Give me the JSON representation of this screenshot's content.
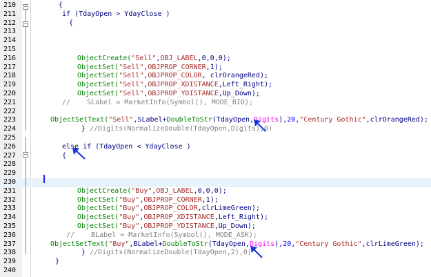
{
  "colors": {
    "keyword": "#000080",
    "function": "#008000",
    "string": "#a52a2a",
    "constant": "#0000ff",
    "digits": "#ff00ff",
    "comment": "#808080",
    "plain": "#000080",
    "arrow": "#1a39d6"
  },
  "lines": [
    {
      "num": "210",
      "indent": 85,
      "tokens": [
        {
          "t": "{",
          "c": "plain"
        }
      ]
    },
    {
      "num": "211",
      "indent": 90,
      "tokens": [
        {
          "t": "if (TdayOpen > YdayClose )",
          "c": "plain"
        }
      ]
    },
    {
      "num": "212",
      "indent": 100,
      "tokens": [
        {
          "t": "{",
          "c": "plain"
        }
      ]
    },
    {
      "num": "213",
      "indent": 100,
      "tokens": []
    },
    {
      "num": "214",
      "indent": 100,
      "tokens": []
    },
    {
      "num": "215",
      "indent": 100,
      "tokens": []
    },
    {
      "num": "216",
      "indent": 112,
      "tokens": [
        {
          "t": "ObjectCreate(",
          "c": "function"
        },
        {
          "t": "\"Sell\"",
          "c": "string"
        },
        {
          "t": ",",
          "c": "plain"
        },
        {
          "t": "OBJ_LABEL",
          "c": "string"
        },
        {
          "t": ",0,0,0);",
          "c": "plain"
        }
      ]
    },
    {
      "num": "217",
      "indent": 112,
      "tokens": [
        {
          "t": "ObjectSet(",
          "c": "function"
        },
        {
          "t": "\"Sell\"",
          "c": "string"
        },
        {
          "t": ",",
          "c": "plain"
        },
        {
          "t": "OBJPROP_CORNER",
          "c": "string"
        },
        {
          "t": ",1);",
          "c": "plain"
        }
      ]
    },
    {
      "num": "218",
      "indent": 112,
      "tokens": [
        {
          "t": "ObjectSet(",
          "c": "function"
        },
        {
          "t": "\"Sell\"",
          "c": "string"
        },
        {
          "t": ",",
          "c": "plain"
        },
        {
          "t": "OBJPROP_COLOR",
          "c": "string"
        },
        {
          "t": ", clrOrangeRed);",
          "c": "plain"
        }
      ]
    },
    {
      "num": "219",
      "indent": 112,
      "tokens": [
        {
          "t": "ObjectSet(",
          "c": "function"
        },
        {
          "t": "\"Sell\"",
          "c": "string"
        },
        {
          "t": ",",
          "c": "plain"
        },
        {
          "t": "OBJPROP_XDISTANCE",
          "c": "string"
        },
        {
          "t": ",Left_Right);",
          "c": "plain"
        }
      ]
    },
    {
      "num": "220",
      "indent": 112,
      "tokens": [
        {
          "t": "ObjectSet(",
          "c": "function"
        },
        {
          "t": "\"Sell\"",
          "c": "string"
        },
        {
          "t": ",",
          "c": "plain"
        },
        {
          "t": "OBJPROP_YDISTANCE",
          "c": "string"
        },
        {
          "t": ",Up_Down);",
          "c": "plain"
        }
      ]
    },
    {
      "num": "221",
      "indent": 90,
      "tokens": [
        {
          "t": "//    SLabel = MarketInfo(Symbol(), MODE_BID);",
          "c": "comment"
        }
      ]
    },
    {
      "num": "222",
      "indent": 90,
      "tokens": []
    },
    {
      "num": "223",
      "indent": 73,
      "tokens": [
        {
          "t": "ObjectSetText(",
          "c": "function"
        },
        {
          "t": "\"Sell\"",
          "c": "string"
        },
        {
          "t": ",SLabel+",
          "c": "plain"
        },
        {
          "t": "DoubleToStr",
          "c": "function"
        },
        {
          "t": "(TdayOpen,",
          "c": "plain"
        },
        {
          "t": "Digits",
          "c": "digits"
        },
        {
          "t": "),",
          "c": "plain"
        },
        {
          "t": "20",
          "c": "constant"
        },
        {
          "t": ",",
          "c": "plain"
        },
        {
          "t": "\"Century Gothic\"",
          "c": "string"
        },
        {
          "t": ",clrOrangeRed);",
          "c": "plain"
        }
      ]
    },
    {
      "num": "224",
      "indent": 118,
      "tokens": [
        {
          "t": "} ",
          "c": "plain"
        },
        {
          "t": "//Digits(NormalizeDouble(TdayOpen,Digits),0)",
          "c": "comment"
        }
      ]
    },
    {
      "num": "225",
      "indent": 90,
      "tokens": []
    },
    {
      "num": "226",
      "indent": 90,
      "tokens": [
        {
          "t": "else if (TdayOpen < YdayClose )",
          "c": "plain"
        }
      ]
    },
    {
      "num": "227",
      "indent": 90,
      "tokens": [
        {
          "t": "{",
          "c": "plain"
        }
      ]
    },
    {
      "num": "228",
      "indent": 90,
      "tokens": []
    },
    {
      "num": "229",
      "indent": 90,
      "tokens": []
    },
    {
      "num": "230",
      "indent": 90,
      "tokens": [],
      "current": true
    },
    {
      "num": "231",
      "indent": 112,
      "tokens": [
        {
          "t": "ObjectCreate(",
          "c": "function"
        },
        {
          "t": "\"Buy\"",
          "c": "string"
        },
        {
          "t": ",",
          "c": "plain"
        },
        {
          "t": "OBJ_LABEL",
          "c": "string"
        },
        {
          "t": ",0,0,0);",
          "c": "plain"
        }
      ]
    },
    {
      "num": "232",
      "indent": 112,
      "tokens": [
        {
          "t": "ObjectSet(",
          "c": "function"
        },
        {
          "t": "\"Buy\"",
          "c": "string"
        },
        {
          "t": ",",
          "c": "plain"
        },
        {
          "t": "OBJPROP_CORNER",
          "c": "string"
        },
        {
          "t": ",1);",
          "c": "plain"
        }
      ]
    },
    {
      "num": "233",
      "indent": 112,
      "tokens": [
        {
          "t": "ObjectSet(",
          "c": "function"
        },
        {
          "t": "\"Buy\"",
          "c": "string"
        },
        {
          "t": ",",
          "c": "plain"
        },
        {
          "t": "OBJPROP_COLOR",
          "c": "string"
        },
        {
          "t": ",clrLimeGreen);",
          "c": "plain"
        }
      ]
    },
    {
      "num": "234",
      "indent": 112,
      "tokens": [
        {
          "t": "ObjectSet(",
          "c": "function"
        },
        {
          "t": "\"Buy\"",
          "c": "string"
        },
        {
          "t": ",",
          "c": "plain"
        },
        {
          "t": "OBJPROP_XDISTANCE",
          "c": "string"
        },
        {
          "t": ",Left_Right);",
          "c": "plain"
        }
      ]
    },
    {
      "num": "235",
      "indent": 112,
      "tokens": [
        {
          "t": "ObjectSet(",
          "c": "function"
        },
        {
          "t": "\"Buy\"",
          "c": "string"
        },
        {
          "t": ",",
          "c": "plain"
        },
        {
          "t": "OBJPROP_YDISTANCE",
          "c": "string"
        },
        {
          "t": ",Up_Down);",
          "c": "plain"
        }
      ]
    },
    {
      "num": "236",
      "indent": 96,
      "tokens": [
        {
          "t": "//    BLabel = MarketInfo(Symbol(), MODE_ASK);",
          "c": "comment"
        }
      ]
    },
    {
      "num": "237",
      "indent": 73,
      "tokens": [
        {
          "t": "ObjectSetText(",
          "c": "function"
        },
        {
          "t": "\"Buy\"",
          "c": "string"
        },
        {
          "t": ",BLabel+",
          "c": "plain"
        },
        {
          "t": "DoubleToStr",
          "c": "function"
        },
        {
          "t": "(TdayOpen,",
          "c": "plain"
        },
        {
          "t": "Digits",
          "c": "digits"
        },
        {
          "t": "),",
          "c": "plain"
        },
        {
          "t": "20",
          "c": "constant"
        },
        {
          "t": ",",
          "c": "plain"
        },
        {
          "t": "\"Century Gothic\"",
          "c": "string"
        },
        {
          "t": ",clrLimeGreen);",
          "c": "plain"
        }
      ]
    },
    {
      "num": "238",
      "indent": 118,
      "tokens": [
        {
          "t": "} ",
          "c": "plain"
        },
        {
          "t": "//Digits(NormalizeDouble(TdayOpen,2),0)",
          "c": "comment"
        }
      ]
    },
    {
      "num": "239",
      "indent": 80,
      "tokens": [
        {
          "t": "}",
          "c": "plain"
        }
      ]
    },
    {
      "num": "240",
      "indent": 80,
      "tokens": []
    }
  ]
}
